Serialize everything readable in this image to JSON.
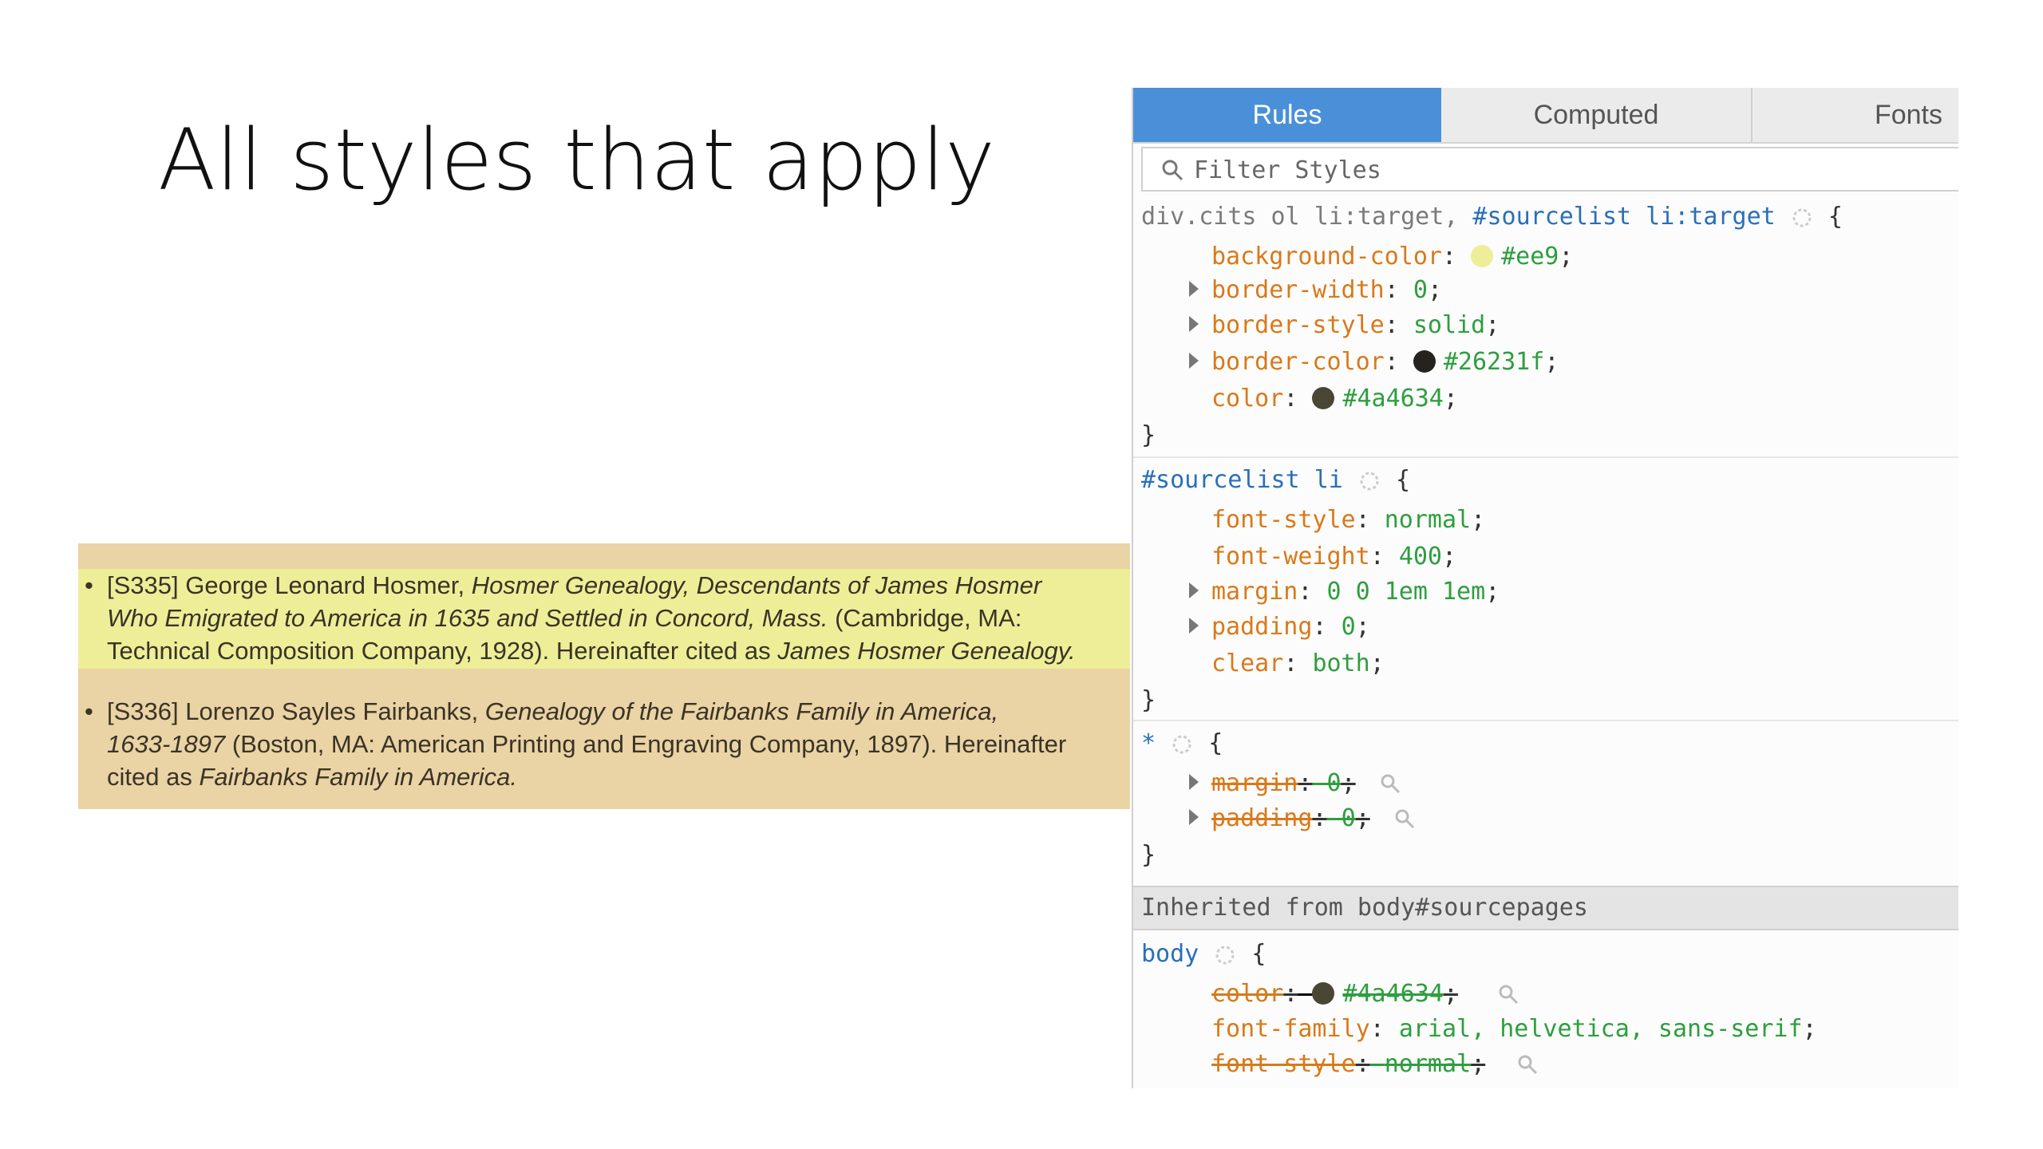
{
  "slide": {
    "title": "All styles that apply"
  },
  "citations": [
    {
      "id": "[S335]",
      "author": "George Leonard Hosmer,",
      "title_italic_1": "Hosmer Genealogy, Descendants of James Hosmer",
      "title_italic_2": "Who Emigrated to America in 1635 and Settled in Concord, Mass.",
      "pub_1": "(Cambridge, MA:",
      "pub_2": "Technical Composition Company, 1928). Hereinafter cited as",
      "short_title": "James Hosmer Genealogy."
    },
    {
      "id": "[S336]",
      "author": "Lorenzo Sayles Fairbanks,",
      "title_italic_1": "Genealogy of the Fairbanks Family in America,",
      "title_italic_2": "1633-1897",
      "pub_1": "(Boston, MA: American Printing and Engraving Company, 1897). Hereinafter",
      "pub_2": "cited as",
      "short_title": "Fairbanks Family in America."
    }
  ],
  "devtools": {
    "tabs": [
      {
        "label": "Rules",
        "active": true
      },
      {
        "label": "Computed",
        "active": false
      },
      {
        "label": "Fonts",
        "active": false
      }
    ],
    "filter_placeholder": "Filter Styles",
    "rule1": {
      "selector_a": "div.cits ol li:target,",
      "selector_b": "#sourcelist li:target",
      "decls": [
        {
          "prop": "background-color",
          "value": "#ee9",
          "swatch": "#eeee99"
        },
        {
          "prop": "border-width",
          "value": "0"
        },
        {
          "prop": "border-style",
          "value": "solid"
        },
        {
          "prop": "border-color",
          "value": "#26231f",
          "swatch": "#26231f"
        },
        {
          "prop": "color",
          "value": "#4a4634",
          "swatch": "#4a4634"
        }
      ]
    },
    "rule2": {
      "selector": "#sourcelist li",
      "decls": [
        {
          "prop": "font-style",
          "value": "normal"
        },
        {
          "prop": "font-weight",
          "value": "400"
        },
        {
          "prop": "margin",
          "value": "0 0 1em 1em"
        },
        {
          "prop": "padding",
          "value": "0"
        },
        {
          "prop": "clear",
          "value": "both"
        }
      ]
    },
    "rule3": {
      "selector": "*",
      "decls": [
        {
          "prop": "margin",
          "value": "0"
        },
        {
          "prop": "padding",
          "value": "0"
        }
      ]
    },
    "inherited_label": "Inherited from body#sourcepages",
    "rule4": {
      "selector": "body",
      "decls": [
        {
          "prop": "color",
          "value": "#4a4634",
          "swatch": "#4a4634"
        },
        {
          "prop": "font-family",
          "value": "arial, helvetica, sans-serif"
        },
        {
          "prop": "font-style",
          "value": "normal"
        }
      ]
    },
    "open_brace": "{",
    "close_brace": "}",
    "colon": ":",
    "semicolon": ";"
  }
}
